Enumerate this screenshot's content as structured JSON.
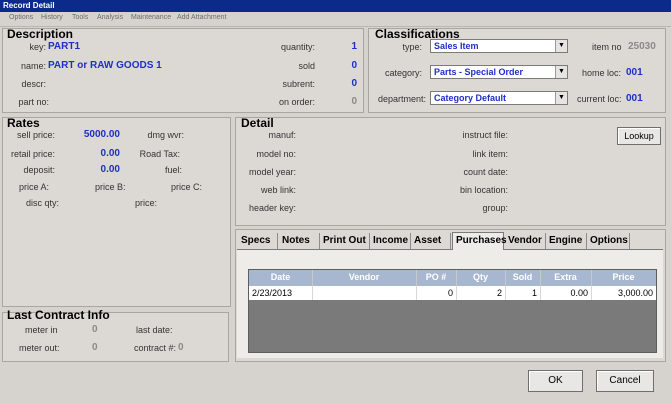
{
  "window": {
    "title": "Record Detail"
  },
  "menu": [
    "Options",
    "History",
    "Tools",
    "Analysis",
    "Maintenance",
    "Add Attachment"
  ],
  "description": {
    "title": "Description",
    "key_label": "key:",
    "key_value": "PART1",
    "name_label": "name:",
    "name_value": "PART or RAW GOODS 1",
    "descr_label": "descr:",
    "partno_label": "part no:",
    "quantity_label": "quantity:",
    "quantity_value": "1",
    "sold_label": "sold",
    "sold_value": "0",
    "subrent_label": "subrent:",
    "subrent_value": "0",
    "onorder_label": "on order:",
    "onorder_value": "0"
  },
  "classifications": {
    "title": "Classifications",
    "type_label": "type:",
    "type_value": "Sales Item",
    "category_label": "category:",
    "category_value": "Parts - Special Order",
    "department_label": "department:",
    "department_value": "Category Default",
    "itemno_label": "item no",
    "itemno_value": "25030",
    "homeloc_label": "home loc:",
    "homeloc_value": "001",
    "currentloc_label": "current loc:",
    "currentloc_value": "001"
  },
  "rates": {
    "title": "Rates",
    "sell_label": "sell price:",
    "sell_value": "5000.00",
    "retail_label": "retail price:",
    "retail_value": "0.00",
    "deposit_label": "deposit:",
    "deposit_value": "0.00",
    "dmgwvr_label": "dmg wvr:",
    "roadtax_label": "Road Tax:",
    "fuel_label": "fuel:",
    "priceA_label": "price A:",
    "priceB_label": "price B:",
    "priceC_label": "price C:",
    "discqty_label": "disc qty:",
    "price_label": "price:"
  },
  "detail": {
    "title": "Detail",
    "manuf_label": "manuf:",
    "modelno_label": "model no:",
    "modelyear_label": "model year:",
    "weblink_label": "web link:",
    "headerkey_label": "header key:",
    "instructfile_label": "instruct file:",
    "linkitem_label": "link item:",
    "countdate_label": "count date:",
    "binlocation_label": "bin location:",
    "group_label": "group:",
    "lookup_label": "Lookup"
  },
  "tabs": [
    "Specs",
    "Notes",
    "Print Out",
    "Income",
    "Asset",
    "Purchases",
    "Vendor",
    "Engine",
    "Options"
  ],
  "active_tab": "Purchases",
  "purchases": {
    "columns": [
      "Date",
      "Vendor",
      "PO #",
      "Qty",
      "Sold",
      "Extra",
      "Price"
    ],
    "rows": [
      {
        "date": "2/23/2013",
        "vendor": "",
        "po": "0",
        "qty": "2",
        "sold": "1",
        "extra": "0.00",
        "price": "3,000.00"
      }
    ]
  },
  "last_contract": {
    "title": "Last Contract Info",
    "meterin_label": "meter in",
    "meterin_value": "0",
    "meterout_label": "meter out:",
    "meterout_value": "0",
    "lastdate_label": "last date:",
    "contract_label": "contract #:",
    "contract_value": "0"
  },
  "buttons": {
    "ok": "OK",
    "cancel": "Cancel"
  },
  "colors": {
    "titlebar": "#0b2a8a",
    "value_blue": "#1e2ec8",
    "grid_header": "#a8b7d0",
    "grid_bg": "#7a7a7a"
  }
}
